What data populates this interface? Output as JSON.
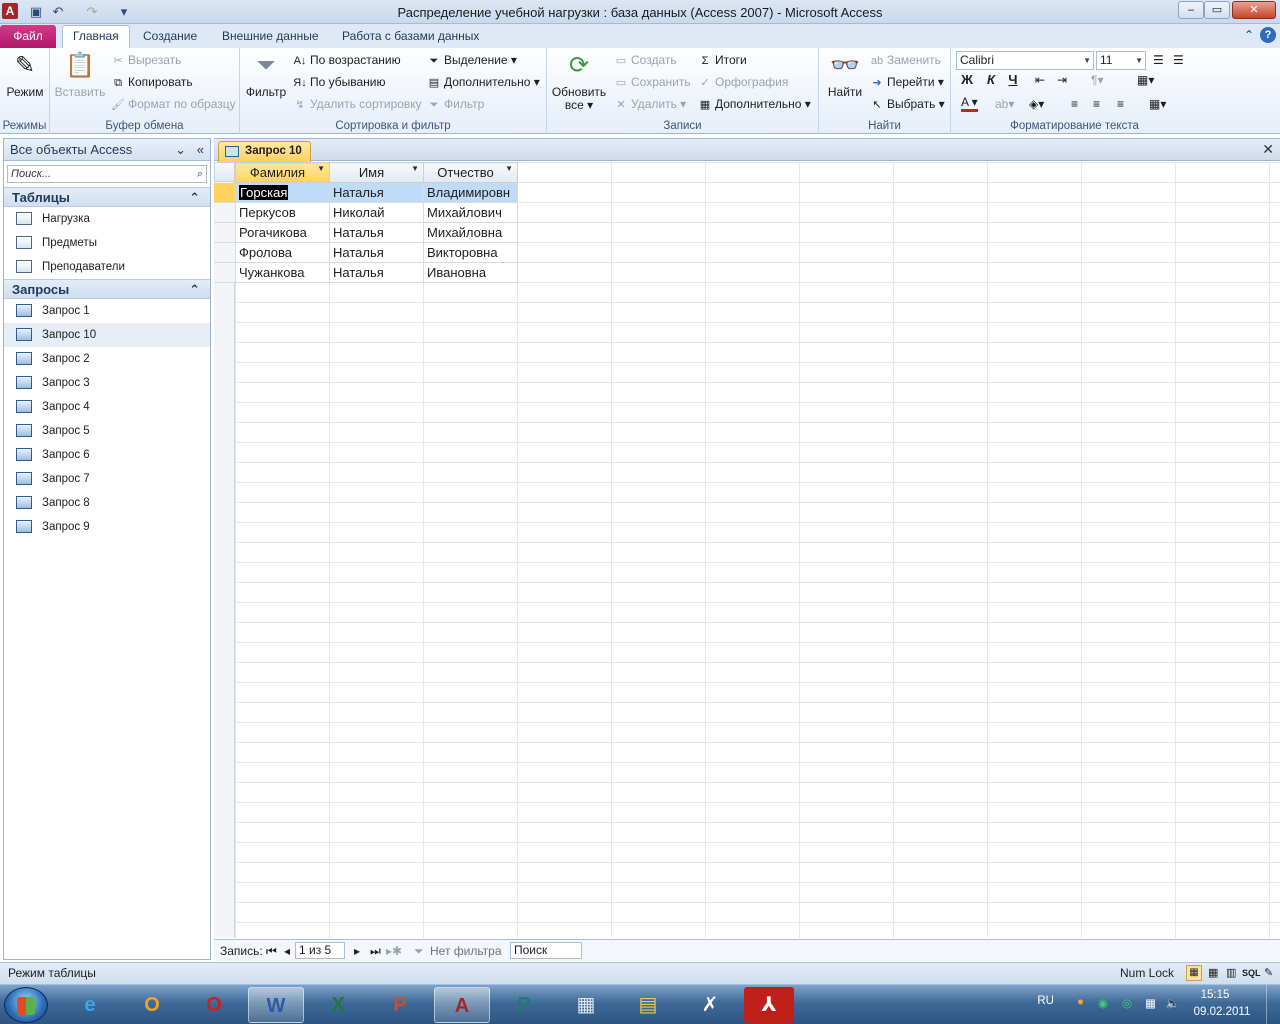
{
  "window": {
    "title": "Распределение учебной нагрузки : база данных (Access 2007)  -  Microsoft Access",
    "min": "–",
    "max": "▭",
    "close": "✕"
  },
  "ribbon_tabs": {
    "file": "Файл",
    "home": "Главная",
    "create": "Создание",
    "external": "Внешние данные",
    "dbtools": "Работа с базами данных"
  },
  "ribbon": {
    "views": {
      "label": "Режимы",
      "mode": "Режим"
    },
    "clipboard": {
      "label": "Буфер обмена",
      "paste": "Вставить",
      "cut": "Вырезать",
      "copy": "Копировать",
      "format_painter": "Формат по образцу"
    },
    "sort_filter": {
      "label": "Сортировка и фильтр",
      "filter": "Фильтр",
      "asc": "По возрастанию",
      "desc": "По убыванию",
      "remove_sort": "Удалить сортировку",
      "selection": "Выделение",
      "advanced": "Дополнительно",
      "toggle_filter": "Фильтр"
    },
    "records": {
      "label": "Записи",
      "refresh": "Обновить",
      "refresh2": "все",
      "new": "Создать",
      "save": "Сохранить",
      "delete": "Удалить",
      "totals": "Итоги",
      "spelling": "Орфография",
      "more": "Дополнительно"
    },
    "find": {
      "label": "Найти",
      "find": "Найти",
      "replace": "Заменить",
      "goto": "Перейти",
      "select": "Выбрать"
    },
    "text_format": {
      "label": "Форматирование текста",
      "font": "Calibri",
      "size": "11",
      "bold": "Ж",
      "italic": "К",
      "underline": "Ч"
    }
  },
  "nav": {
    "title": "Все объекты Access",
    "search_placeholder": "Поиск...",
    "tables_header": "Таблицы",
    "tables": [
      "Нагрузка",
      "Предметы",
      "Преподаватели"
    ],
    "queries_header": "Запросы",
    "queries": [
      "Запрос 1",
      "Запрос 10",
      "Запрос 2",
      "Запрос 3",
      "Запрос 4",
      "Запрос 5",
      "Запрос 6",
      "Запрос 7",
      "Запрос 8",
      "Запрос 9"
    ],
    "selected_query": "Запрос 10"
  },
  "doc": {
    "tab": "Запрос 10",
    "columns": [
      "Фамилия",
      "Имя",
      "Отчество"
    ],
    "rows": [
      [
        "Горская",
        "Наталья",
        "Владимировн"
      ],
      [
        "Перкусов",
        "Николай",
        "Михайлович"
      ],
      [
        "Рогачикова",
        "Наталья",
        "Михайловна"
      ],
      [
        "Фролова",
        "Наталья",
        "Викторовна"
      ],
      [
        "Чужанкова",
        "Наталья",
        "Ивановна"
      ]
    ]
  },
  "record_nav": {
    "label": "Запись:",
    "position": "1 из 5",
    "filter": "Нет фильтра",
    "search": "Поиск"
  },
  "status": {
    "mode": "Режим таблицы",
    "numlock": "Num Lock"
  },
  "tray": {
    "lang": "RU",
    "time": "15:15",
    "date": "09.02.2011"
  }
}
